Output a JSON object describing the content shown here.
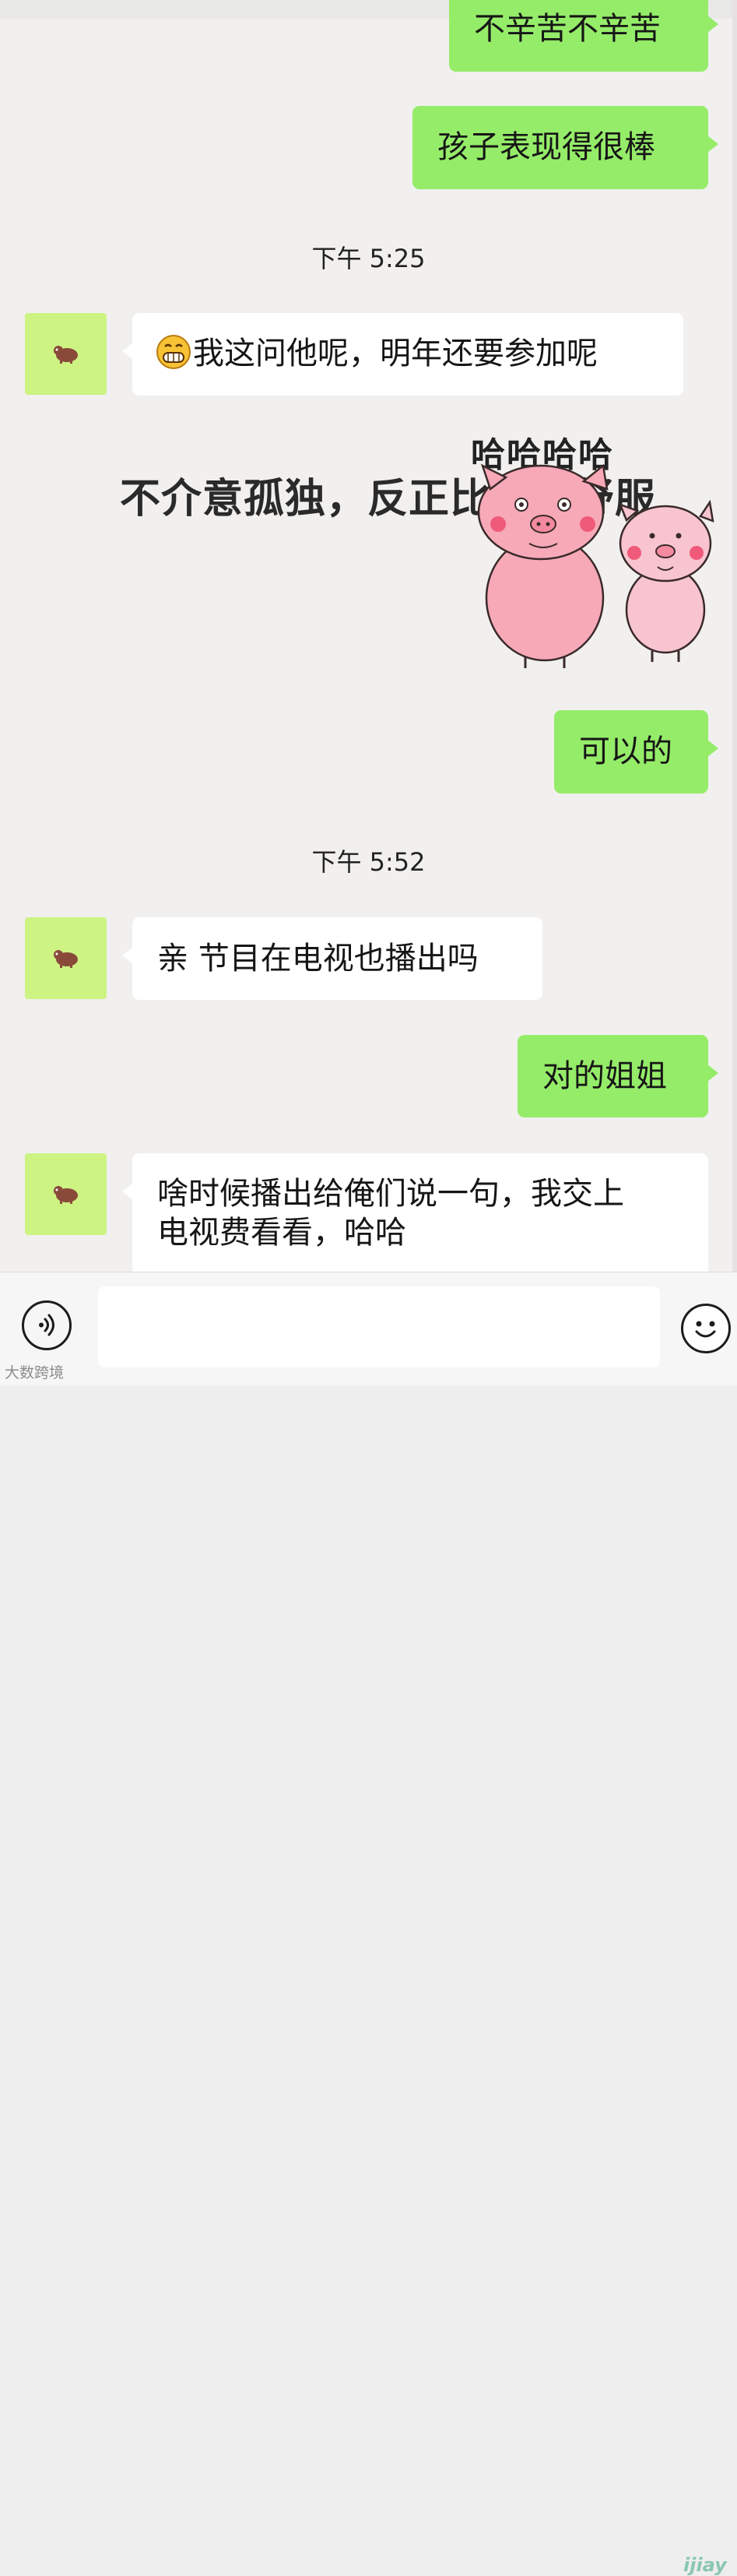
{
  "messages": {
    "m1": {
      "text": "不辛苦不辛苦"
    },
    "m2": {
      "text": "孩子表现得很棒"
    },
    "ts1": "下午 5:25",
    "m3": {
      "text": "我这问他呢，明年还要参加呢",
      "emoji": "grinning-face-icon"
    },
    "sticker": {
      "caption": "不介意孤独，反正比爱你舒服",
      "haha": "哈哈哈哈",
      "icon": "pink-pigs-sticker"
    },
    "m4": {
      "text": "可以的"
    },
    "ts2": "下午 5:52",
    "m5": {
      "text": "亲 节目在电视也播出吗"
    },
    "m6": {
      "text": "对的姐姐"
    },
    "m7": {
      "line1": "啥时候播出给俺们说一句，我交上",
      "line2": "电视费看看，哈哈"
    }
  },
  "input_bar": {
    "voice_icon": "voice-icon",
    "placeholder": "",
    "emoji_icon": "emoji-icon"
  },
  "watermark": "大数跨境",
  "logo_mark": "ijiay",
  "colors": {
    "sent_bubble": "#95ec69",
    "recv_bubble": "#ffffff",
    "avatar_bg": "#cdf383",
    "chat_bg": "#f1f0ee"
  }
}
